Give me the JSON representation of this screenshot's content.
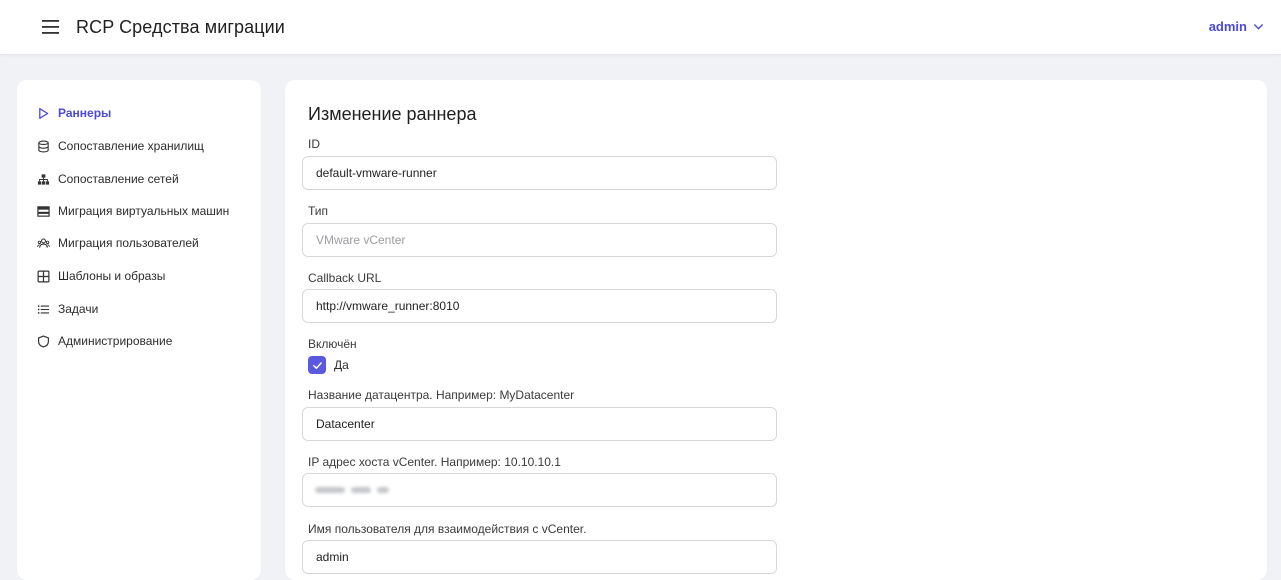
{
  "header": {
    "app_title": "RCP Средства миграции",
    "user_name": "admin"
  },
  "colors": {
    "accent": "#4b49d6",
    "checkbox": "#5b59e0",
    "background": "#f0f2f5",
    "panel": "#ffffff"
  },
  "sidebar": {
    "items": [
      {
        "label": "Раннеры",
        "icon": "play-outline-icon",
        "active": true
      },
      {
        "label": "Сопоставление хранилищ",
        "icon": "database-icon"
      },
      {
        "label": "Сопоставление сетей",
        "icon": "network-nodes-icon"
      },
      {
        "label": "Миграция виртуальных машин",
        "icon": "server-rack-icon"
      },
      {
        "label": "Миграция пользователей",
        "icon": "users-group-icon"
      },
      {
        "label": "Шаблоны и образы",
        "icon": "grid-squares-icon"
      },
      {
        "label": "Задачи",
        "icon": "list-icon"
      },
      {
        "label": "Администрирование",
        "icon": "shield-icon"
      }
    ]
  },
  "form": {
    "title": "Изменение раннера",
    "id_label": "ID",
    "id_value": "default-vmware-runner",
    "type_label": "Тип",
    "type_value": "VMware vCenter",
    "callback_label": "Callback URL",
    "callback_value": "http://vmware_runner:8010",
    "enabled_label": "Включён",
    "enabled_checked": true,
    "enabled_option": "Да",
    "datacenter_label": "Название датацентра. Например: MyDatacenter",
    "datacenter_value": "Datacenter",
    "vcenter_ip_label": "IP адрес хоста vCenter. Например: 10.10.10.1",
    "vcenter_user_label": "Имя пользователя для взаимодействия с vCenter.",
    "vcenter_user_value": "admin"
  }
}
